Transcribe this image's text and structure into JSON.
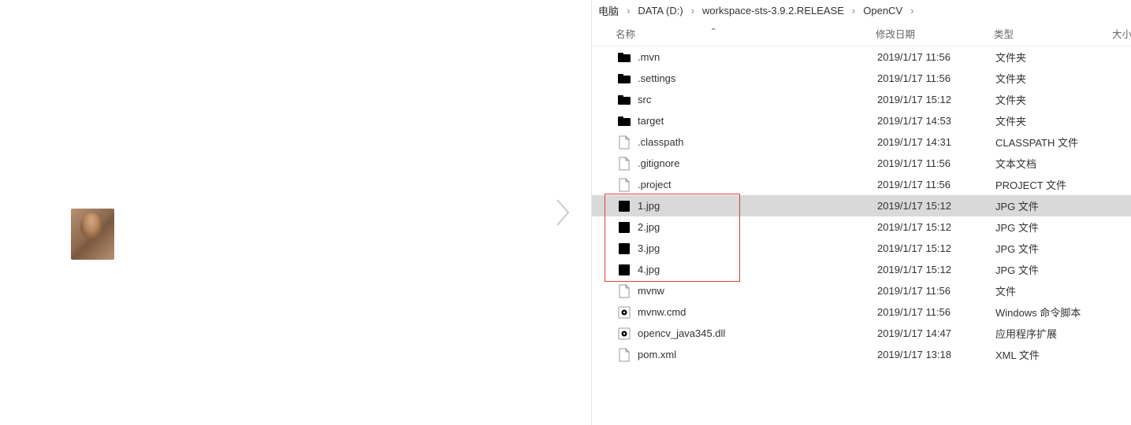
{
  "breadcrumb": {
    "items": [
      "电脑",
      "DATA (D:)",
      "workspace-sts-3.9.2.RELEASE",
      "OpenCV"
    ]
  },
  "columns": {
    "name": "名称",
    "date": "修改日期",
    "type": "类型",
    "size": "大小"
  },
  "sort_column": "name",
  "files": [
    {
      "name": ".mvn",
      "date": "2019/1/17 11:56",
      "type": "文件夹",
      "icon": "folder"
    },
    {
      "name": ".settings",
      "date": "2019/1/17 11:56",
      "type": "文件夹",
      "icon": "folder"
    },
    {
      "name": "src",
      "date": "2019/1/17 15:12",
      "type": "文件夹",
      "icon": "folder"
    },
    {
      "name": "target",
      "date": "2019/1/17 14:53",
      "type": "文件夹",
      "icon": "folder"
    },
    {
      "name": ".classpath",
      "date": "2019/1/17 14:31",
      "type": "CLASSPATH 文件",
      "icon": "file"
    },
    {
      "name": ".gitignore",
      "date": "2019/1/17 11:56",
      "type": "文本文档",
      "icon": "file"
    },
    {
      "name": ".project",
      "date": "2019/1/17 11:56",
      "type": "PROJECT 文件",
      "icon": "file"
    },
    {
      "name": "1.jpg",
      "date": "2019/1/17 15:12",
      "type": "JPG 文件",
      "icon": "image",
      "selected": true
    },
    {
      "name": "2.jpg",
      "date": "2019/1/17 15:12",
      "type": "JPG 文件",
      "icon": "image"
    },
    {
      "name": "3.jpg",
      "date": "2019/1/17 15:12",
      "type": "JPG 文件",
      "icon": "image"
    },
    {
      "name": "4.jpg",
      "date": "2019/1/17 15:12",
      "type": "JPG 文件",
      "icon": "image"
    },
    {
      "name": "mvnw",
      "date": "2019/1/17 11:56",
      "type": "文件",
      "icon": "file"
    },
    {
      "name": "mvnw.cmd",
      "date": "2019/1/17 11:56",
      "type": "Windows 命令脚本",
      "icon": "cmd"
    },
    {
      "name": "opencv_java345.dll",
      "date": "2019/1/17 14:47",
      "type": "应用程序扩展",
      "icon": "cmd"
    },
    {
      "name": "pom.xml",
      "date": "2019/1/17 13:18",
      "type": "XML 文件",
      "icon": "file"
    }
  ],
  "highlight": {
    "from_index": 7,
    "to_index": 10
  }
}
